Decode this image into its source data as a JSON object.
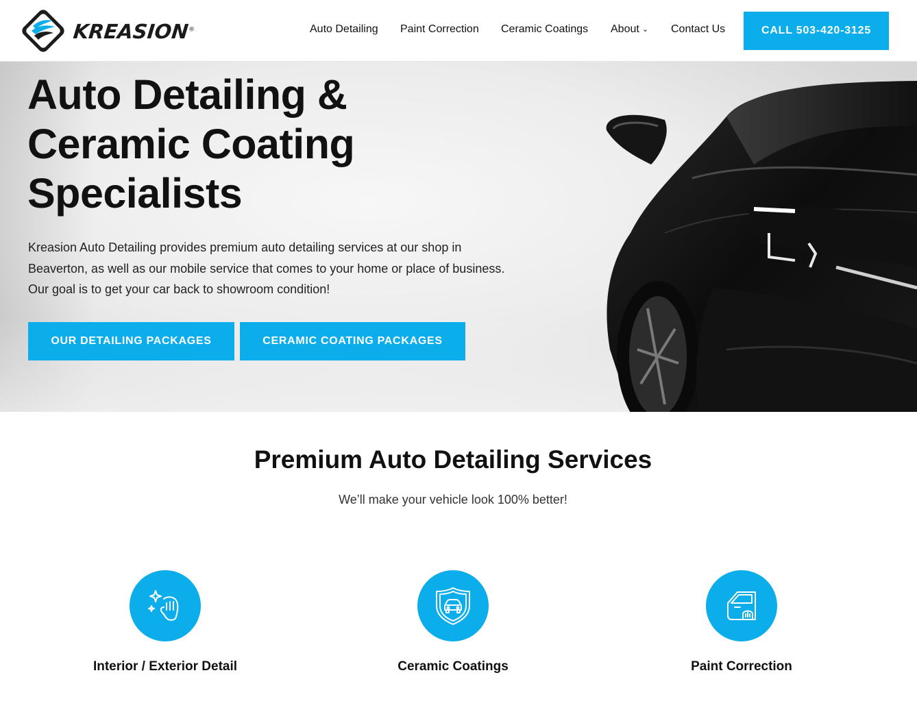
{
  "brand": {
    "name": "KREASION",
    "reg_mark": "®"
  },
  "nav": {
    "items": [
      {
        "label": "Auto Detailing"
      },
      {
        "label": "Paint Correction"
      },
      {
        "label": "Ceramic Coatings"
      },
      {
        "label": "About",
        "chevron": "⌄"
      },
      {
        "label": "Contact Us"
      }
    ],
    "call_label": "CALL 503-420-3125"
  },
  "hero": {
    "title_lines": [
      "Auto Detailing &",
      "Ceramic Coating",
      "Specialists"
    ],
    "description": "Kreasion Auto Detailing provides premium auto detailing services at our shop in Beaverton, as well as our mobile service that comes to your home or place of business. Our goal is to get your car back to showroom condition!",
    "buttons": [
      "OUR DETAILING PACKAGES",
      "CERAMIC COATING PACKAGES"
    ]
  },
  "services": {
    "title": "Premium Auto Detailing Services",
    "subtitle": "We’ll make your vehicle look 100% better!",
    "items": [
      {
        "label": "Interior / Exterior Detail",
        "icon": "sparkle-hand-icon"
      },
      {
        "label": "Ceramic Coatings",
        "icon": "shield-car-icon"
      },
      {
        "label": "Paint Correction",
        "icon": "car-door-icon"
      }
    ]
  },
  "colors": {
    "accent": "#0cadeb",
    "text": "#111111"
  }
}
